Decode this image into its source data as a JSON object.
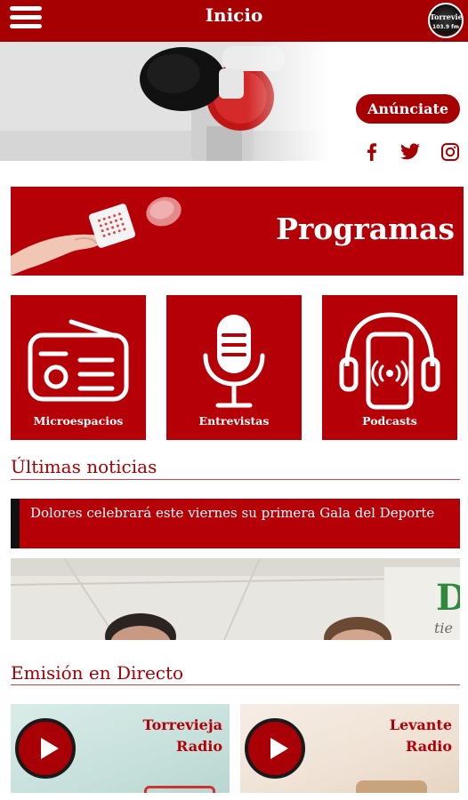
{
  "header": {
    "title": "Inicio",
    "logo_line1": "Torrevieja",
    "logo_line2": "103.9 fm"
  },
  "hero": {
    "cta_label": "Anúnciate",
    "social": [
      "facebook-icon",
      "twitter-icon",
      "instagram-icon"
    ]
  },
  "programas": {
    "title": "Programas"
  },
  "tiles": [
    {
      "label": "Microespacios",
      "icon": "radio-icon"
    },
    {
      "label": "Entrevistas",
      "icon": "microphone-icon"
    },
    {
      "label": "Podcasts",
      "icon": "podcast-phone-icon"
    }
  ],
  "news": {
    "heading": "Últimas noticias",
    "item_title": "Dolores celebrará este viernes su primera Gala del Deporte"
  },
  "live": {
    "heading": "Emisión en Directo",
    "stations": [
      {
        "line1": "Torrevieja",
        "line2": "Radio"
      },
      {
        "line1": "Levante",
        "line2": "Radio"
      }
    ]
  },
  "colors": {
    "brand_red": "#a60003",
    "tile_red": "#b40006",
    "white": "#ffffff"
  }
}
